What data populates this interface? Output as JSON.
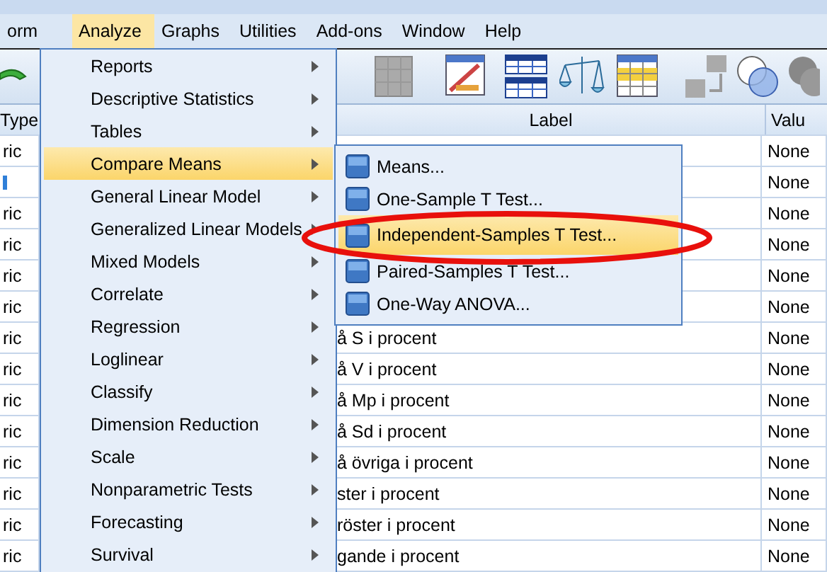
{
  "menubar": [
    {
      "label": "orm",
      "selected": false
    },
    {
      "label": "Analyze",
      "selected": true
    },
    {
      "label": "Graphs",
      "selected": false
    },
    {
      "label": "Utilities",
      "selected": false
    },
    {
      "label": "Add-ons",
      "selected": false
    },
    {
      "label": "Window",
      "selected": false
    },
    {
      "label": "Help",
      "selected": false
    }
  ],
  "grid": {
    "columns": [
      "Type",
      "Label",
      "Valu"
    ],
    "rows": [
      {
        "type": {
          "kind": "text",
          "text": "ric"
        },
        "values": "None"
      },
      {
        "type": {
          "kind": "icon"
        },
        "values": "None"
      },
      {
        "type": {
          "kind": "text",
          "text": "ric"
        },
        "values": "None"
      },
      {
        "type": {
          "kind": "text",
          "text": "ric"
        },
        "values": "None"
      },
      {
        "type": {
          "kind": "text",
          "text": "ric"
        },
        "values": "None"
      },
      {
        "type": {
          "kind": "text",
          "text": "ric"
        },
        "values": "None"
      },
      {
        "type": {
          "kind": "text",
          "text": "ric"
        },
        "label": "å S i procent",
        "values": "None"
      },
      {
        "type": {
          "kind": "text",
          "text": "ric"
        },
        "label": "å V i procent",
        "values": "None"
      },
      {
        "type": {
          "kind": "text",
          "text": "ric"
        },
        "label": "å Mp i procent",
        "values": "None"
      },
      {
        "type": {
          "kind": "text",
          "text": "ric"
        },
        "label": "å Sd i procent",
        "values": "None"
      },
      {
        "type": {
          "kind": "text",
          "text": "ric"
        },
        "label": "å övriga i procent",
        "values": "None"
      },
      {
        "type": {
          "kind": "text",
          "text": "ric"
        },
        "label": "ster i procent",
        "values": "None"
      },
      {
        "type": {
          "kind": "text",
          "text": "ric"
        },
        "label": "röster i procent",
        "values": "None"
      },
      {
        "type": {
          "kind": "text",
          "text": "ric"
        },
        "label": "gande i procent",
        "values": "None"
      }
    ]
  },
  "analyze_menu": [
    {
      "label": "Reports",
      "selected": false
    },
    {
      "label": "Descriptive Statistics",
      "selected": false
    },
    {
      "label": "Tables",
      "selected": false
    },
    {
      "label": "Compare Means",
      "selected": true
    },
    {
      "label": "General Linear Model",
      "selected": false
    },
    {
      "label": "Generalized Linear Models",
      "selected": false
    },
    {
      "label": "Mixed Models",
      "selected": false
    },
    {
      "label": "Correlate",
      "selected": false
    },
    {
      "label": "Regression",
      "selected": false
    },
    {
      "label": "Loglinear",
      "selected": false
    },
    {
      "label": "Classify",
      "selected": false
    },
    {
      "label": "Dimension Reduction",
      "selected": false
    },
    {
      "label": "Scale",
      "selected": false
    },
    {
      "label": "Nonparametric Tests",
      "selected": false
    },
    {
      "label": "Forecasting",
      "selected": false
    },
    {
      "label": "Survival",
      "selected": false
    }
  ],
  "compare_means_menu": [
    {
      "label": "Means...",
      "selected": false
    },
    {
      "label": "One-Sample T Test...",
      "selected": false
    },
    {
      "label": "Independent-Samples T Test...",
      "selected": true
    },
    {
      "label": "Paired-Samples T Test...",
      "selected": false
    },
    {
      "label": "One-Way ANOVA...",
      "selected": false
    }
  ]
}
